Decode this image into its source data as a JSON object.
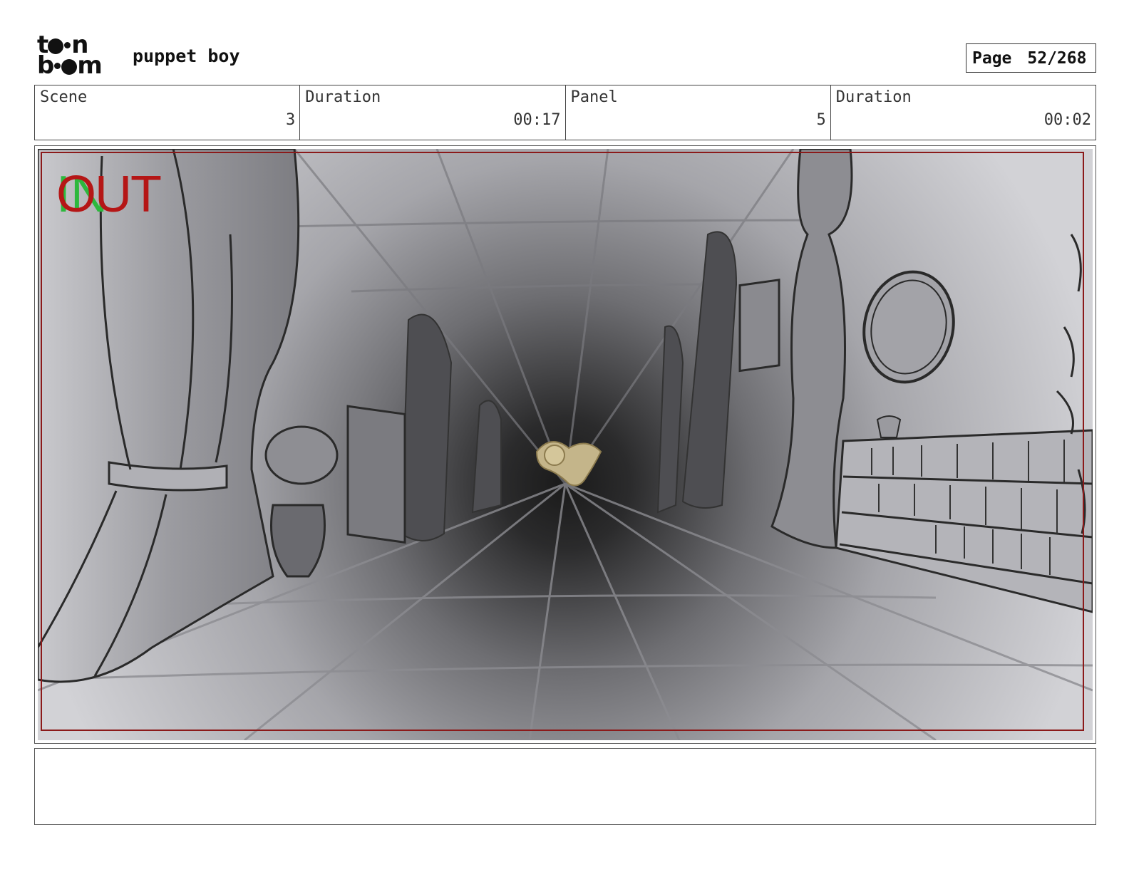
{
  "header": {
    "logo_line1": "t  n",
    "logo_line2": "b  m",
    "project_title": "puppet boy",
    "page_label": "Page",
    "page_value": "52/268"
  },
  "info": {
    "scene_label": "Scene",
    "scene_value": "3",
    "scene_duration_label": "Duration",
    "scene_duration_value": "00:17",
    "panel_label": "Panel",
    "panel_value": "5",
    "panel_duration_label": "Duration",
    "panel_duration_value": "00:02"
  },
  "panel": {
    "in_marker": "IN",
    "out_marker": "OUT"
  },
  "colors": {
    "in_marker": "#2db83d",
    "out_marker": "#b51616",
    "safe_frame": "#8b1a1a"
  }
}
